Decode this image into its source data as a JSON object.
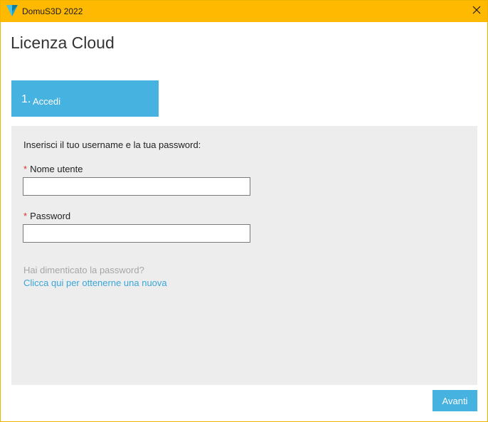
{
  "window": {
    "title": "DomuS3D 2022",
    "icon": "domus3d-logo-icon",
    "close_icon": "close-icon",
    "titlebar_color": "#ffb900"
  },
  "page": {
    "title": "Licenza Cloud"
  },
  "step": {
    "number": "1.",
    "label": "Accedi",
    "color": "#45b2e0"
  },
  "form": {
    "instructions": "Inserisci il tuo username e la tua password:",
    "required_marker": "*",
    "username": {
      "label": "Nome utente",
      "value": "",
      "placeholder": ""
    },
    "password": {
      "label": "Password",
      "value": "",
      "placeholder": ""
    },
    "forgot_text": "Hai dimenticato la password?",
    "forgot_link": "Clicca qui per ottenerne una nuova"
  },
  "footer": {
    "next_label": "Avanti"
  }
}
